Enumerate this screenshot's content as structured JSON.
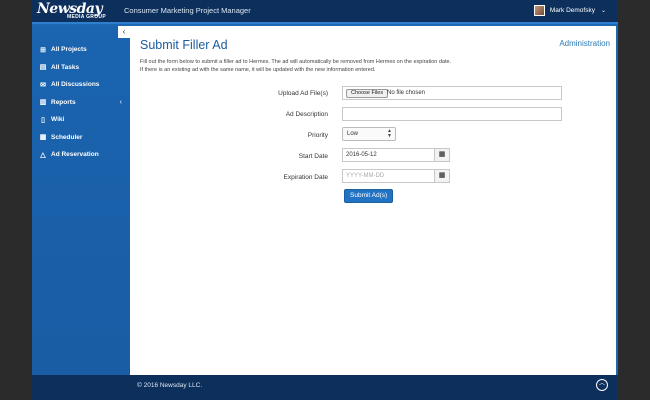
{
  "header": {
    "logo_main": "Newsday",
    "logo_sub": "MEDIA GROUP",
    "app_title": "Consumer Marketing Project Manager",
    "user_name": "Mark Demofsky"
  },
  "sidebar": {
    "collapse_label": "‹",
    "items": [
      {
        "label": "All Projects",
        "icon": "sitemap-icon",
        "glyph": "⊞"
      },
      {
        "label": "All Tasks",
        "icon": "tasks-icon",
        "glyph": "▤"
      },
      {
        "label": "All Discussions",
        "icon": "comments-icon",
        "glyph": "✉"
      },
      {
        "label": "Reports",
        "icon": "bar-chart-icon",
        "glyph": "▥",
        "caret": "‹"
      },
      {
        "label": "Wiki",
        "icon": "file-icon",
        "glyph": "▯"
      },
      {
        "label": "Scheduler",
        "icon": "calendar-icon",
        "glyph": "▦"
      },
      {
        "label": "Ad Reservation",
        "icon": "bell-icon",
        "glyph": "△"
      }
    ]
  },
  "main": {
    "title": "Submit Filler Ad",
    "admin_link": "Administration",
    "intro_line1": "Fill out the form below to submit a filler ad to Hermes. The ad will automatically be removed from Hermes on the expiration date.",
    "intro_line2": "If there is an existing ad with the same name, it will be updated with the new information entered."
  },
  "form": {
    "upload_label": "Upload Ad File(s)",
    "choose_files_label": "Choose Files",
    "no_file_text": "No file chosen",
    "description_label": "Ad Description",
    "description_value": "",
    "priority_label": "Priority",
    "priority_value": "Low",
    "start_date_label": "Start Date",
    "start_date_value": "2016-05-12",
    "expiration_label": "Expiration Date",
    "expiration_placeholder": "YYYY-MM-DD",
    "submit_label": "Submit Ad(s)"
  },
  "footer": {
    "copyright": "© 2016 Newsday LLC."
  }
}
